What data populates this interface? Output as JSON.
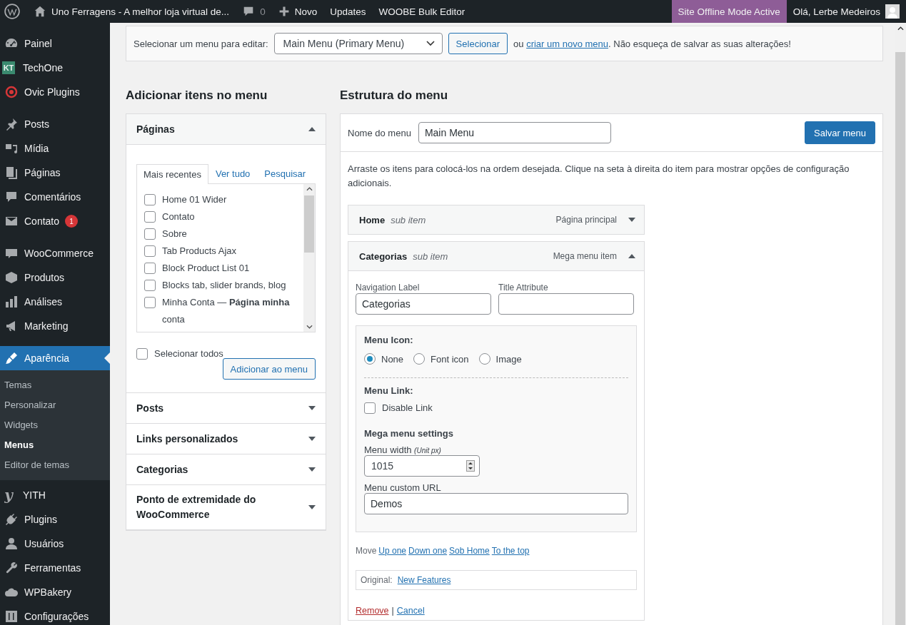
{
  "topbar": {
    "site_title": "Uno Ferragens - A melhor loja virtual de...",
    "comments": "0",
    "new_label": "Novo",
    "links": [
      "Updates",
      "WOOBE Bulk Editor"
    ],
    "offline_badge": "Site Offline Mode Active",
    "greeting": "Olá, Lerbe Medeiros"
  },
  "sidebar": {
    "sections": [
      [
        {
          "label": "Painel",
          "selected": false
        },
        {
          "label": "TechOne",
          "selected": false,
          "icon_text": "KT"
        },
        {
          "label": "Ovic Plugins",
          "selected": false
        }
      ],
      [
        {
          "label": "Posts",
          "selected": false
        },
        {
          "label": "Mídia",
          "selected": false
        },
        {
          "label": "Páginas",
          "selected": false
        },
        {
          "label": "Comentários",
          "selected": false
        },
        {
          "label": "Contato",
          "selected": false,
          "badge": "1"
        }
      ],
      [
        {
          "label": "WooCommerce",
          "selected": false
        },
        {
          "label": "Produtos",
          "selected": false
        },
        {
          "label": "Análises",
          "selected": false
        },
        {
          "label": "Marketing",
          "selected": false
        }
      ],
      [
        {
          "label": "Aparência",
          "selected": true,
          "children": [
            {
              "label": "Temas",
              "selected": false
            },
            {
              "label": "Personalizar",
              "selected": false
            },
            {
              "label": "Widgets",
              "selected": false
            },
            {
              "label": "Menus",
              "selected": true
            },
            {
              "label": "Editor de temas",
              "selected": false
            }
          ]
        },
        {
          "label": "YITH",
          "selected": false,
          "icon_text": "y"
        },
        {
          "label": "Plugins",
          "selected": false
        },
        {
          "label": "Usuários",
          "selected": false
        },
        {
          "label": "Ferramentas",
          "selected": false
        },
        {
          "label": "WPBakery",
          "selected": false
        },
        {
          "label": "Configurações",
          "selected": false
        }
      ]
    ]
  },
  "menu_selector": {
    "label": "Selecionar um menu para editar:",
    "value": "Main Menu (Primary Menu)",
    "button": "Selecionar",
    "note_prefix": "ou",
    "note_link": "criar um novo menu",
    "note_suffix": ". Não esqueça de salvar as suas alterações!"
  },
  "add_items": {
    "heading": "Adicionar itens no menu",
    "sections": [
      {
        "title": "Páginas",
        "expanded": true,
        "tabs": [
          {
            "label": "Mais recentes",
            "selected": true
          },
          {
            "label": "Ver tudo",
            "selected": false
          },
          {
            "label": "Pesquisar",
            "selected": false
          }
        ],
        "items": [
          {
            "label": "Home 01 Wider",
            "checked": false
          },
          {
            "label": "Contato",
            "checked": false
          },
          {
            "label": "Sobre",
            "checked": false
          },
          {
            "label": "Tab Products Ajax",
            "checked": false
          },
          {
            "label": "Block Product List 01",
            "checked": false
          },
          {
            "label": "Blocks tab, slider brands, blog",
            "checked": false
          },
          {
            "label": "Minha Conta — **Página minha** conta",
            "checked": false
          }
        ],
        "select_all": {
          "label": "Selecionar todos",
          "checked": false
        },
        "button": "Adicionar ao menu"
      },
      {
        "title": "Posts",
        "expanded": false
      },
      {
        "title": "Links personalizados",
        "expanded": false
      },
      {
        "title": "Categorias",
        "expanded": false
      },
      {
        "title": "Ponto de extremidade do WooCommerce",
        "expanded": false
      }
    ]
  },
  "structure": {
    "heading": "Estrutura do menu",
    "name_label": "Nome do menu",
    "name_value": "Main Menu",
    "save_button": "Salvar menu",
    "instructions": "Arraste os itens para colocá-los na ordem desejada. Clique na seta à direita do item para mostrar opções de configuração adicionais.",
    "items": [
      {
        "title": "Home",
        "subtitle": "sub item",
        "type": "Página principal",
        "expanded": false
      },
      {
        "title": "Categorias",
        "subtitle": "sub item",
        "type": "Mega menu item",
        "expanded": true,
        "settings": {
          "nav_label": "Navigation Label",
          "nav_value": "Categorias",
          "title_label": "Title Attribute",
          "icon_heading": "Menu Icon:",
          "icon_options": [
            {
              "label": "None",
              "selected": true
            },
            {
              "label": "Font icon",
              "selected": false
            },
            {
              "label": "Image",
              "selected": false
            }
          ],
          "link_heading": "Menu Link:",
          "disable_link": {
            "label": "Disable Link",
            "checked": false
          },
          "mega_heading": "Mega menu settings",
          "width_label": "Menu width",
          "width_unit": "(Unit px)",
          "width_value": "1015",
          "url_label": "Menu custom URL",
          "url_value": "Demos",
          "move_label": "Move",
          "move_links": [
            "Up one",
            "Down one",
            "Sob Home",
            "To the top"
          ],
          "original_label": "Original:",
          "original_link": "New Features",
          "remove": "Remove",
          "separator": "|",
          "cancel": "Cancel"
        }
      }
    ]
  }
}
